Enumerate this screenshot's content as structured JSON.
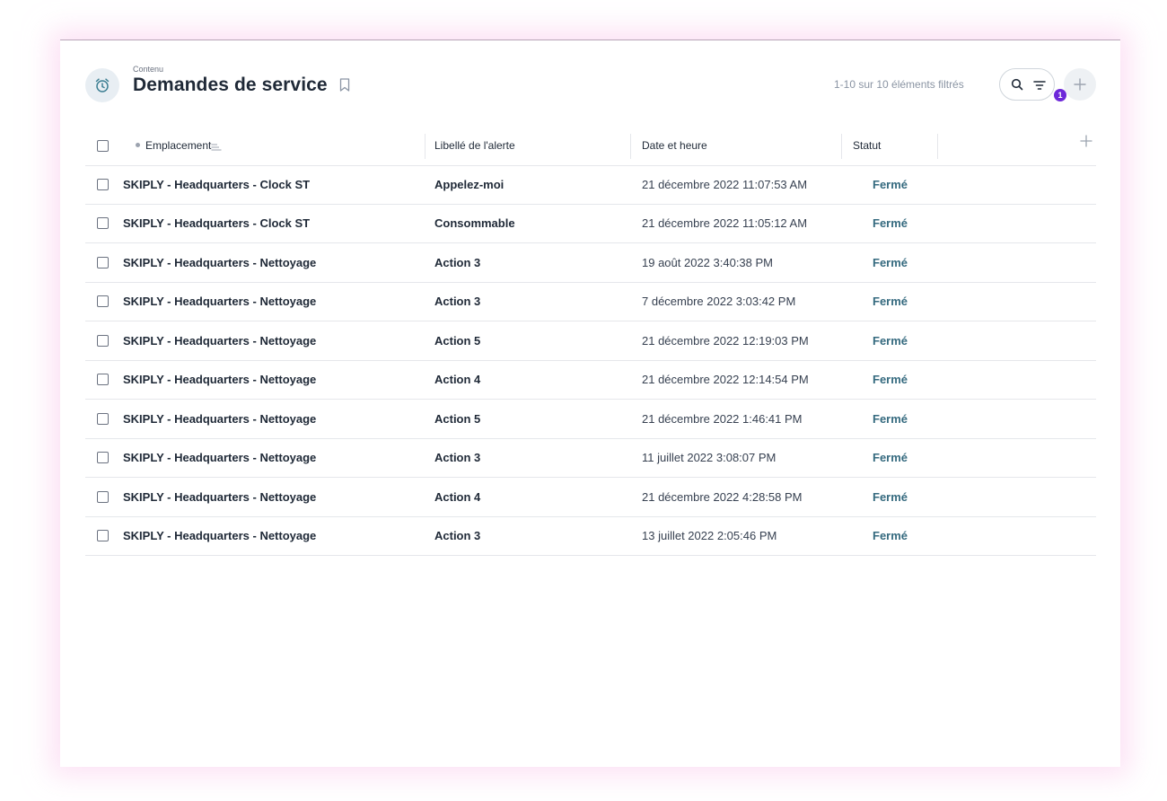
{
  "header": {
    "breadcrumb": "Contenu",
    "title": "Demandes de service",
    "result_count": "1-10 sur 10 éléments filtrés",
    "filter_badge": "1",
    "icons": {
      "page": "alarm-clock-icon",
      "bookmark": "bookmark-icon",
      "search": "search-icon",
      "filter": "filter-icon",
      "add": "plus-icon"
    }
  },
  "table": {
    "columns": [
      "Emplacement",
      "Libellé de l'alerte",
      "Date et heure",
      "Statut"
    ],
    "rows": [
      {
        "location": "SKIPLY - Headquarters - Clock ST",
        "alert": "Appelez-moi",
        "datetime": "21 décembre 2022 11:07:53 AM",
        "status": "Fermé"
      },
      {
        "location": "SKIPLY - Headquarters - Clock ST",
        "alert": "Consommable",
        "datetime": "21 décembre 2022 11:05:12 AM",
        "status": "Fermé"
      },
      {
        "location": "SKIPLY - Headquarters - Nettoyage",
        "alert": "Action 3",
        "datetime": "19 août 2022 3:40:38 PM",
        "status": "Fermé"
      },
      {
        "location": "SKIPLY - Headquarters - Nettoyage",
        "alert": "Action 3",
        "datetime": "7 décembre 2022 3:03:42 PM",
        "status": "Fermé"
      },
      {
        "location": "SKIPLY - Headquarters - Nettoyage",
        "alert": "Action 5",
        "datetime": "21 décembre 2022 12:19:03 PM",
        "status": "Fermé"
      },
      {
        "location": "SKIPLY - Headquarters - Nettoyage",
        "alert": "Action 4",
        "datetime": "21 décembre 2022 12:14:54 PM",
        "status": "Fermé"
      },
      {
        "location": "SKIPLY - Headquarters - Nettoyage",
        "alert": "Action 5",
        "datetime": "21 décembre 2022 1:46:41 PM",
        "status": "Fermé"
      },
      {
        "location": "SKIPLY - Headquarters - Nettoyage",
        "alert": "Action 3",
        "datetime": "11 juillet 2022 3:08:07 PM",
        "status": "Fermé"
      },
      {
        "location": "SKIPLY - Headquarters - Nettoyage",
        "alert": "Action 4",
        "datetime": "21 décembre 2022 4:28:58 PM",
        "status": "Fermé"
      },
      {
        "location": "SKIPLY - Headquarters - Nettoyage",
        "alert": "Action 3",
        "datetime": "13 juillet 2022 2:05:46 PM",
        "status": "Fermé"
      }
    ]
  },
  "colors": {
    "status_closed": "#356a7f",
    "filter_badge": "#6d28d9",
    "icon_accent": "#3d7f93"
  }
}
